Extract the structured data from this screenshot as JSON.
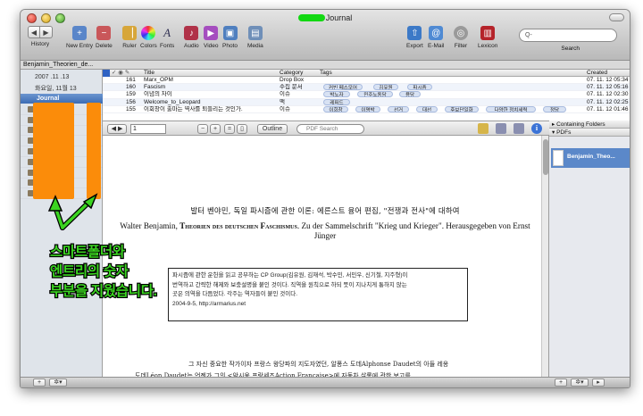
{
  "window": {
    "title": "Journal"
  },
  "toolbar": {
    "history": "History",
    "new_entry": "New Entry",
    "delete": "Delete",
    "ruler": "Ruler",
    "colors": "Colors",
    "fonts": "Fonts",
    "audio": "Audio",
    "video": "Video",
    "photo": "Photo",
    "media": "Media",
    "export": "Export",
    "email": "E-Mail",
    "filter": "Filter",
    "lexicon": "Lexicon",
    "search_label": "Search",
    "search_placeholder": "Q-"
  },
  "pathbar": "Benjamin_Theorien_de...",
  "sidebar": {
    "date1": "2007 .11 .13",
    "date2": "화요일, 11월 13",
    "selected": "Journal"
  },
  "table": {
    "headers": {
      "title": "Title",
      "category": "Category",
      "tags": "Tags",
      "created": "Created"
    },
    "rows": [
      {
        "id": "161",
        "title": "Marx_OPM",
        "category": "Drop Box",
        "tags": [],
        "created": "07. 11. 12  05:34"
      },
      {
        "id": "160",
        "title": "Fascism",
        "category": "수집 문서",
        "tags": [
          "커빈 페스모어",
          "김유원",
          "파시즘"
        ],
        "created": "07. 11. 12  05:16"
      },
      {
        "id": "159",
        "title": "이념의 차이",
        "category": "이슈",
        "tags": [
          "박노자",
          "민주노동당",
          "용당"
        ],
        "created": "07. 11. 12  02:30"
      },
      {
        "id": "156",
        "title": "Welcome_to_Leopard",
        "category": "맥",
        "tags": [
          "레퍼드"
        ],
        "created": "07. 11. 12  02:25"
      },
      {
        "id": "155",
        "title": "이회창이 출마는 역사를 퇴들리는 것인가.",
        "category": "이슈",
        "tags": [
          "이회창",
          "이명박",
          "선거",
          "대선",
          "후보단일화",
          "다양한 정치세력",
          "정당"
        ],
        "created": "07. 11. 12  01:46"
      }
    ]
  },
  "doc_toolbar": {
    "page": "1",
    "outline": "Outline",
    "pdf_search_placeholder": "PDF Search"
  },
  "document": {
    "heading_ko": "발터 벤야민, 독일 파시즘에 관한 이론: 에른스트 융어 편집, \"전쟁과 전사\"에 대하여",
    "heading_de_prefix": "Walter Benjamin, ",
    "heading_de_title": "Theorien des deutschen Faschismus",
    "heading_de_rest": ". Zu der Sammelschrift \"Krieg und Krieger\". Herausgegeben von Ernst Jünger",
    "box_line1": "파시즘에 관한 운헌을 읽고 공부하는 CP Group(김유원, 김재석, 박수민, 서민우, 신기철, 지주형)이",
    "box_line2": "번역하고 간략한 해제와 보충설명을 붙인 것이다. 직역을 원칙으로 하되 뜻이 지나치게 통하지 않는",
    "box_line3": "곳은 의역을 다듬었다. 각주는 역자들이 붙인 것이다.",
    "box_line4": "2004-9-5, http://armarius.net",
    "body_line1": "그 자신 중요한 작가이자 프랑스 왕당파의 지도자였던, 알퐁스 도데Alphonse Daudet의 아들 레옹",
    "body_line2": "도데Léon Daudet는 언젠가 그의 <악시옹 프랑세즈Action Française>에 자동차 살롱에 관한 보고를"
  },
  "inspector": {
    "containing_folders": "Containing Folders",
    "pdfs": "PDFs",
    "pdf_item": "Benjamin_Theo..."
  },
  "annotation": {
    "line1": "스마트폴더와",
    "line2": "엔트리의 숫자",
    "line3": "부분을 지웠습니다."
  },
  "colors": {
    "annotation_green": "#3bd421",
    "redaction_orange": "#fb8c0a",
    "selection_blue": "#3c6cb4"
  }
}
